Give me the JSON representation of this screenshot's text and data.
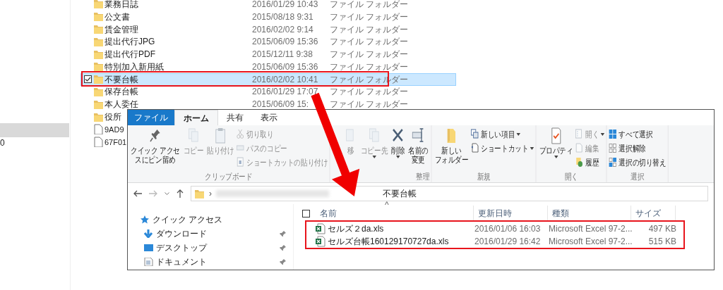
{
  "background_nav": {
    "cut_text": "0"
  },
  "background_list": {
    "rows": [
      {
        "kind": "folder",
        "name": "業務日誌",
        "date": "2016/01/29 10:43",
        "type": "ファイル フォルダー",
        "selected": false
      },
      {
        "kind": "folder",
        "name": "公文書",
        "date": "2015/08/18 9:31",
        "type": "ファイル フォルダー",
        "selected": false
      },
      {
        "kind": "folder",
        "name": "賃金管理",
        "date": "2016/02/02 9:14",
        "type": "ファイル フォルダー",
        "selected": false
      },
      {
        "kind": "folder",
        "name": "提出代行JPG",
        "date": "2015/06/09 15:36",
        "type": "ファイル フォルダー",
        "selected": false
      },
      {
        "kind": "folder",
        "name": "提出代行PDF",
        "date": "2015/12/11 9:38",
        "type": "ファイル フォルダー",
        "selected": false
      },
      {
        "kind": "folder",
        "name": "特別加入新用紙",
        "date": "2015/06/09 15:36",
        "type": "ファイル フォルダー",
        "selected": false
      },
      {
        "kind": "folder",
        "name": "不要台帳",
        "date": "2016/02/02 10:41",
        "type": "ファイル フォルダー",
        "selected": true
      },
      {
        "kind": "folder",
        "name": "保存台帳",
        "date": "2016/01/29 17:07",
        "type": "ファイル フォルダー",
        "selected": false
      },
      {
        "kind": "folder",
        "name": "本人委任",
        "date": "2015/06/09 15:",
        "type": "ファイル フォルダー",
        "selected": false
      },
      {
        "kind": "folder",
        "name": "役所",
        "selected": false
      },
      {
        "kind": "file",
        "name": "9AD9",
        "selected": false
      },
      {
        "kind": "file",
        "name": "67F01",
        "selected": false
      }
    ]
  },
  "window": {
    "tabs": [
      {
        "label": "ファイル",
        "kind": "file",
        "selected": false
      },
      {
        "label": "ホーム",
        "kind": "tab",
        "selected": true
      },
      {
        "label": "共有",
        "kind": "tab",
        "selected": false
      },
      {
        "label": "表示",
        "kind": "tab",
        "selected": false
      }
    ],
    "ribbon": {
      "groups": [
        {
          "label": "クリップボード",
          "items": [
            {
              "kind": "large",
              "lines": [
                "クイック アクセ",
                "スにピン留め"
              ],
              "disabled": false,
              "has_menu": false
            },
            {
              "kind": "large",
              "lines": [
                "コピー"
              ],
              "disabled": true,
              "has_menu": false
            },
            {
              "kind": "large",
              "lines": [
                "貼り付け"
              ],
              "disabled": true,
              "has_menu": false
            },
            {
              "kind": "small",
              "lines": [
                "切り取り"
              ],
              "disabled": true,
              "has_menu": false
            },
            {
              "kind": "small",
              "lines": [
                "パスのコピー"
              ],
              "disabled": true,
              "has_menu": false
            },
            {
              "kind": "small",
              "lines": [
                "ショートカットの貼り付け"
              ],
              "disabled": true,
              "has_menu": false
            }
          ]
        },
        {
          "label": "整理",
          "items": [
            {
              "kind": "large",
              "lines": [
                "移"
              ],
              "disabled": true,
              "has_menu": false
            },
            {
              "kind": "large",
              "lines": [
                "コピー先"
              ],
              "disabled": true,
              "has_menu": true
            },
            {
              "kind": "large",
              "lines": [
                "削除"
              ],
              "disabled": false,
              "has_menu": true
            },
            {
              "kind": "large",
              "lines": [
                "名前の",
                "変更"
              ],
              "disabled": false,
              "has_menu": false
            }
          ]
        },
        {
          "label": "新規",
          "items": [
            {
              "kind": "large",
              "lines": [
                "新しい",
                "フォルダー"
              ],
              "disabled": false,
              "has_menu": false
            },
            {
              "kind": "small",
              "lines": [
                "新しい項目"
              ],
              "disabled": false,
              "has_menu": true
            },
            {
              "kind": "small",
              "lines": [
                "ショートカット"
              ],
              "disabled": false,
              "has_menu": true
            }
          ]
        },
        {
          "label": "開く",
          "items": [
            {
              "kind": "large",
              "lines": [
                "プロパティ"
              ],
              "disabled": false,
              "has_menu": true
            },
            {
              "kind": "small",
              "lines": [
                "開く"
              ],
              "disabled": true,
              "has_menu": true
            },
            {
              "kind": "small",
              "lines": [
                "編集"
              ],
              "disabled": true,
              "has_menu": false
            },
            {
              "kind": "small",
              "lines": [
                "履歴"
              ],
              "disabled": false,
              "has_menu": false
            }
          ]
        },
        {
          "label": "選択",
          "items": [
            {
              "kind": "small",
              "lines": [
                "すべて選択"
              ],
              "disabled": false,
              "has_menu": false
            },
            {
              "kind": "small",
              "lines": [
                "選択解除"
              ],
              "disabled": false,
              "has_menu": false
            },
            {
              "kind": "small",
              "lines": [
                "選択の切り替え"
              ],
              "disabled": false,
              "has_menu": false
            }
          ]
        }
      ]
    },
    "address": {
      "separator": "›",
      "current": "不要台帳"
    },
    "nav": [
      {
        "label": "クイック アクセス",
        "pinned": false
      },
      {
        "label": "ダウンロード",
        "pinned": true
      },
      {
        "label": "デスクトップ",
        "pinned": true
      },
      {
        "label": "ドキュメント",
        "pinned": true
      }
    ],
    "select_all_checked": false,
    "columns": [
      "名前",
      "更新日時",
      "種類",
      "サイズ"
    ],
    "sort_mark": "^",
    "files": [
      {
        "name": "セルズ２da.xls",
        "date": "2016/01/06 16:03",
        "type": "Microsoft Excel 97-2...",
        "size": "497 KB"
      },
      {
        "name": "セルズ台帳160129170727da.xls",
        "date": "2016/01/29 16:42",
        "type": "Microsoft Excel 97-2...",
        "size": "515 KB"
      }
    ]
  }
}
